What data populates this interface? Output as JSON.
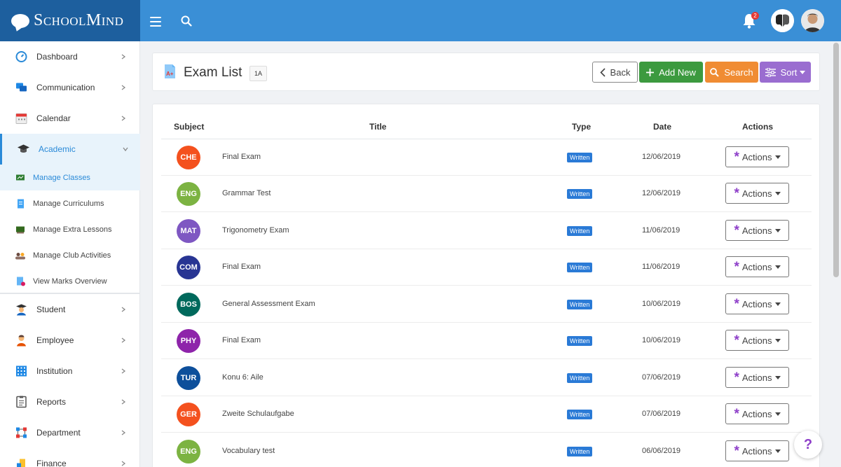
{
  "app": {
    "logo_text": "SchoolMind",
    "notifications_count": "2"
  },
  "sidebar": {
    "items": [
      {
        "label": "Dashboard",
        "icon": "dashboard-icon"
      },
      {
        "label": "Communication",
        "icon": "chat-icon"
      },
      {
        "label": "Calendar",
        "icon": "calendar-icon"
      },
      {
        "label": "Academic",
        "icon": "graduation-cap-icon"
      },
      {
        "label": "Student",
        "icon": "student-icon"
      },
      {
        "label": "Employee",
        "icon": "employee-icon"
      },
      {
        "label": "Institution",
        "icon": "institution-icon"
      },
      {
        "label": "Reports",
        "icon": "reports-icon"
      },
      {
        "label": "Department",
        "icon": "department-icon"
      },
      {
        "label": "Finance",
        "icon": "finance-icon"
      }
    ],
    "subitems": [
      {
        "label": "Manage Classes",
        "icon": "chalkboard-icon"
      },
      {
        "label": "Manage Curriculums",
        "icon": "document-icon"
      },
      {
        "label": "Manage Extra Lessons",
        "icon": "board-icon"
      },
      {
        "label": "Manage Club Activities",
        "icon": "group-icon"
      },
      {
        "label": "View Marks Overview",
        "icon": "marks-icon"
      }
    ]
  },
  "header": {
    "title": "Exam List",
    "class_tag": "1A",
    "back_label": "Back",
    "add_label": "Add New",
    "search_label": "Search",
    "sort_label": "Sort"
  },
  "table": {
    "columns": {
      "subject": "Subject",
      "title": "Title",
      "type": "Type",
      "date": "Date",
      "actions": "Actions"
    },
    "rows": [
      {
        "subject": "CHE",
        "color": "#f4511e",
        "title": "Final Exam",
        "type": "Written",
        "date": "12/06/2019",
        "action": "Actions"
      },
      {
        "subject": "ENG",
        "color": "#7cb342",
        "title": "Grammar Test",
        "type": "Written",
        "date": "12/06/2019",
        "action": "Actions"
      },
      {
        "subject": "MAT",
        "color": "#7e57c2",
        "title": "Trigonometry Exam",
        "type": "Written",
        "date": "11/06/2019",
        "action": "Actions"
      },
      {
        "subject": "COM",
        "color": "#283593",
        "title": "Final Exam",
        "type": "Written",
        "date": "11/06/2019",
        "action": "Actions"
      },
      {
        "subject": "BOS",
        "color": "#00695c",
        "title": "General Assessment Exam",
        "type": "Written",
        "date": "10/06/2019",
        "action": "Actions"
      },
      {
        "subject": "PHY",
        "color": "#8e24aa",
        "title": "Final Exam",
        "type": "Written",
        "date": "10/06/2019",
        "action": "Actions"
      },
      {
        "subject": "TUR",
        "color": "#0d4f9b",
        "title": "Konu 6: Aile",
        "type": "Written",
        "date": "07/06/2019",
        "action": "Actions"
      },
      {
        "subject": "GER",
        "color": "#f4511e",
        "title": "Zweite Schulaufgabe",
        "type": "Written",
        "date": "07/06/2019",
        "action": "Actions"
      },
      {
        "subject": "ENG",
        "color": "#7cb342",
        "title": "Vocabulary test",
        "type": "Written",
        "date": "06/06/2019",
        "action": "Actions"
      }
    ]
  },
  "help": {
    "label": "?"
  }
}
